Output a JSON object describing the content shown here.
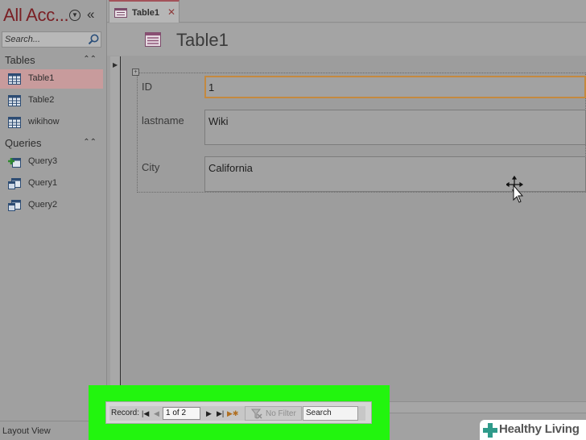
{
  "nav_pane": {
    "title": "All Acc...",
    "search_placeholder": "Search...",
    "groups": [
      {
        "label": "Tables",
        "items": [
          {
            "label": "Table1",
            "selected": true
          },
          {
            "label": "Table2"
          },
          {
            "label": "wikihow"
          }
        ]
      },
      {
        "label": "Queries",
        "items": [
          {
            "label": "Query3"
          },
          {
            "label": "Query1"
          },
          {
            "label": "Query2"
          }
        ]
      }
    ]
  },
  "document_tab": {
    "label": "Table1"
  },
  "form": {
    "title": "Table1",
    "fields": [
      {
        "label": "ID",
        "value": "1"
      },
      {
        "label": "lastname",
        "value": "Wiki"
      },
      {
        "label": "City",
        "value": "California"
      }
    ]
  },
  "record_nav": {
    "label": "Record:",
    "current": "1 of 2",
    "filter_label": "No Filter",
    "search_label": "Search"
  },
  "status_bar": {
    "text": "Layout View"
  },
  "watermark": {
    "text": "Healthy Living"
  },
  "colors": {
    "highlight": "#22f50e",
    "selected_item": "#c89b9c",
    "active_field_border": "#c4893f",
    "title_accent": "#7a1f24"
  },
  "icons": [
    "table-icon",
    "append-query-icon",
    "select-query-icon",
    "search-icon",
    "move-cursor-icon",
    "filter-icon"
  ]
}
